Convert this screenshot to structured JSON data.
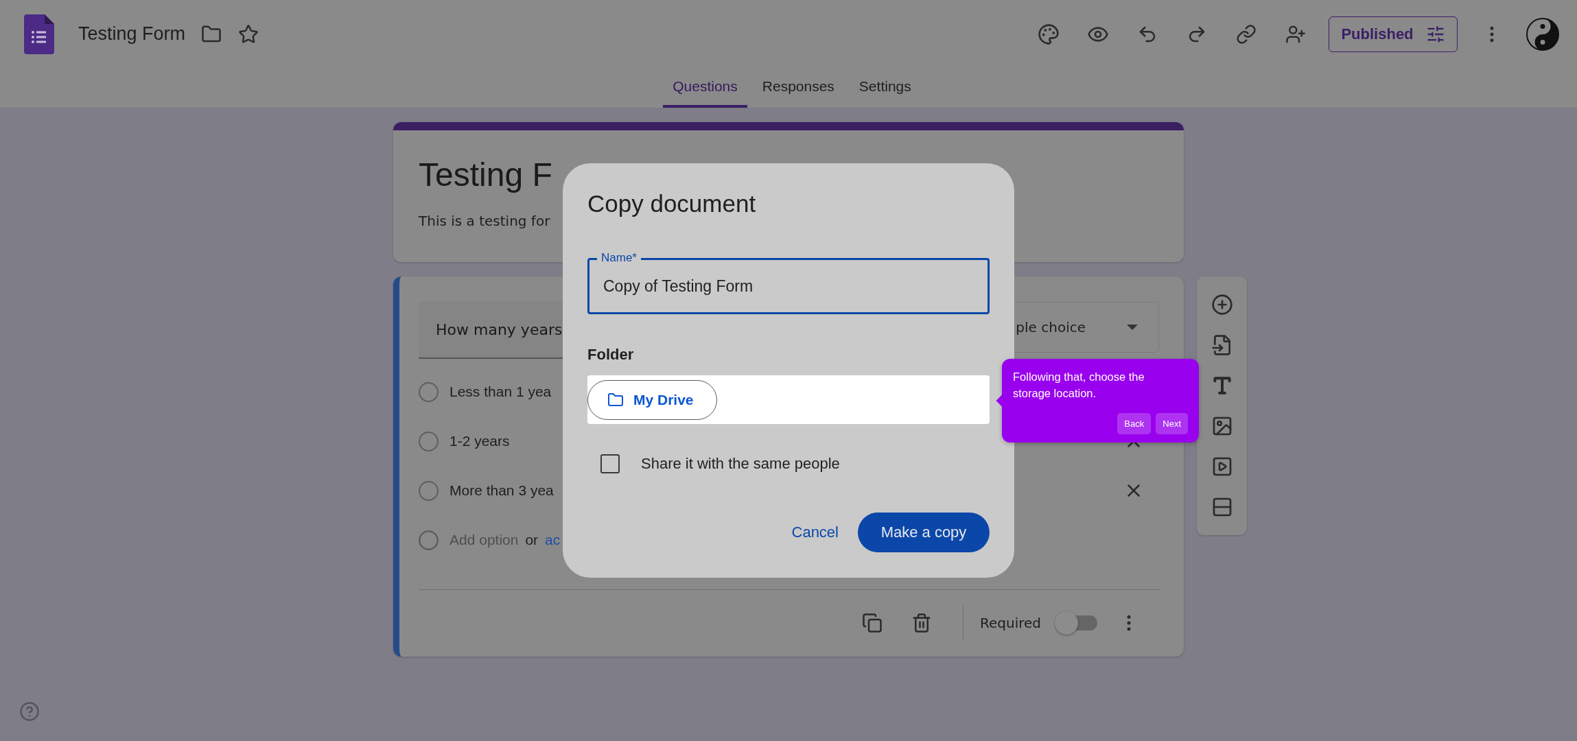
{
  "app": {
    "title": "Testing Form",
    "publish_button": "Published"
  },
  "tabs": [
    {
      "label": "Questions",
      "selected": true
    },
    {
      "label": "Responses",
      "selected": false
    },
    {
      "label": "Settings",
      "selected": false
    }
  ],
  "form": {
    "title": "Testing F",
    "description": "This is a testing for"
  },
  "question": {
    "text": "How many years",
    "type": "ple choice",
    "options": [
      {
        "label": "Less than 1 yea",
        "selected": false,
        "removable": false
      },
      {
        "label": "1-2 years",
        "selected": false,
        "removable": true
      },
      {
        "label": "More than 3 yea",
        "selected": false,
        "removable": true
      }
    ],
    "add_option": "Add option",
    "or": "or",
    "add_other": "ac",
    "required_label": "Required",
    "required": false
  },
  "dialog": {
    "title": "Copy document",
    "name_label": "Name*",
    "name_value": "Copy of Testing Form",
    "folder_label": "Folder",
    "folder": "My Drive",
    "share_label": "Share it with the same people",
    "share_checked": false,
    "cancel": "Cancel",
    "confirm": "Make a copy"
  },
  "tooltip": {
    "text": "Following that, choose the storage location.",
    "back": "Back",
    "next": "Next"
  }
}
